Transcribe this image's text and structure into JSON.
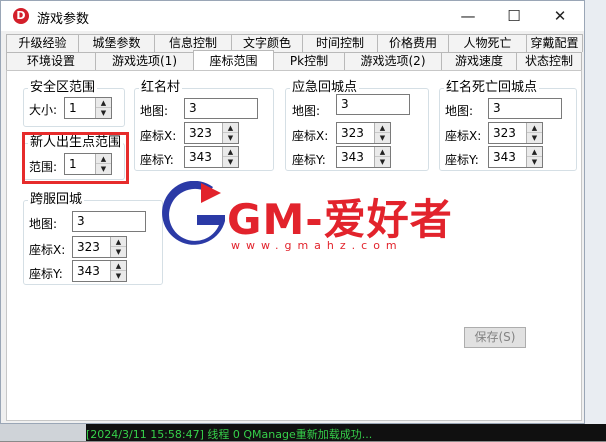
{
  "window": {
    "title": "游戏参数",
    "app_icon_letter": "D",
    "controls": {
      "minimize": "—",
      "maximize": "☐",
      "close": "✕"
    }
  },
  "tabs": {
    "row1": [
      "升级经验",
      "城堡参数",
      "信息控制",
      "文字颜色",
      "时间控制",
      "价格费用",
      "人物死亡",
      "穿戴配置"
    ],
    "row2": [
      "环境设置",
      "游戏选项(1)",
      "座标范围",
      "Pk控制",
      "游戏选项(2)",
      "游戏速度",
      "状态控制"
    ],
    "active": "座标范围"
  },
  "safe_zone": {
    "title": "安全区范围",
    "size_label": "大小:",
    "size_value": "1"
  },
  "newbie_zone": {
    "title": "新人出生点范围",
    "range_label": "范围:",
    "range_value": "1"
  },
  "red_village": {
    "title": "红名村",
    "map_label": "地图:",
    "map_value": "3",
    "x_label": "座标X:",
    "x_value": "323",
    "y_label": "座标Y:",
    "y_value": "343"
  },
  "emergency_return": {
    "title": "应急回城点",
    "map_label": "地图:",
    "map_value": "3",
    "x_label": "座标X:",
    "x_value": "323",
    "y_label": "座标Y:",
    "y_value": "343"
  },
  "red_death_return": {
    "title": "红名死亡回城点",
    "map_label": "地图:",
    "map_value": "3",
    "x_label": "座标X:",
    "x_value": "323",
    "y_label": "座标Y:",
    "y_value": "343"
  },
  "cross_server": {
    "title": "跨服回城",
    "map_label": "地图:",
    "map_value": "3",
    "x_label": "座标X:",
    "x_value": "323",
    "y_label": "座标Y:",
    "y_value": "343"
  },
  "save_button": "保存(S)",
  "watermark": {
    "brand": "GM-爱好者",
    "url": "www.gmahz.com"
  },
  "background_log": "[2024/3/11 15:58:47] 线程 0 QManage重新加载成功..."
}
